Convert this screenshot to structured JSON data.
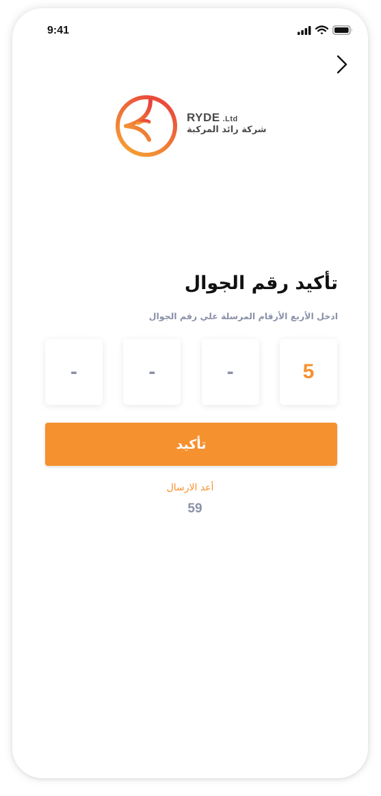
{
  "status_bar": {
    "time": "9:41",
    "icons": [
      "cellular-signal-icon",
      "wifi-icon",
      "battery-icon"
    ]
  },
  "header": {
    "back_icon": "chevron-right-icon"
  },
  "logo": {
    "brand_en": "RYDE",
    "suffix": ".Ltd",
    "brand_ar": "شركة رائد المركبة",
    "mark_icon": "ryde-logo-icon"
  },
  "main": {
    "title": "تأكيد رقم الجوال",
    "subtitle": "ادخل  الأربع الأرقام المرسلة علي رقم الجوال",
    "otp": [
      "-",
      "-",
      "-",
      "5"
    ],
    "confirm_label": "تأكيد",
    "resend_label": "أعد الارسال",
    "countdown": "59"
  },
  "colors": {
    "accent": "#f6912f",
    "muted": "#8a90a8",
    "logo_gradient_start": "#f5a033",
    "logo_gradient_end": "#e8453c"
  }
}
